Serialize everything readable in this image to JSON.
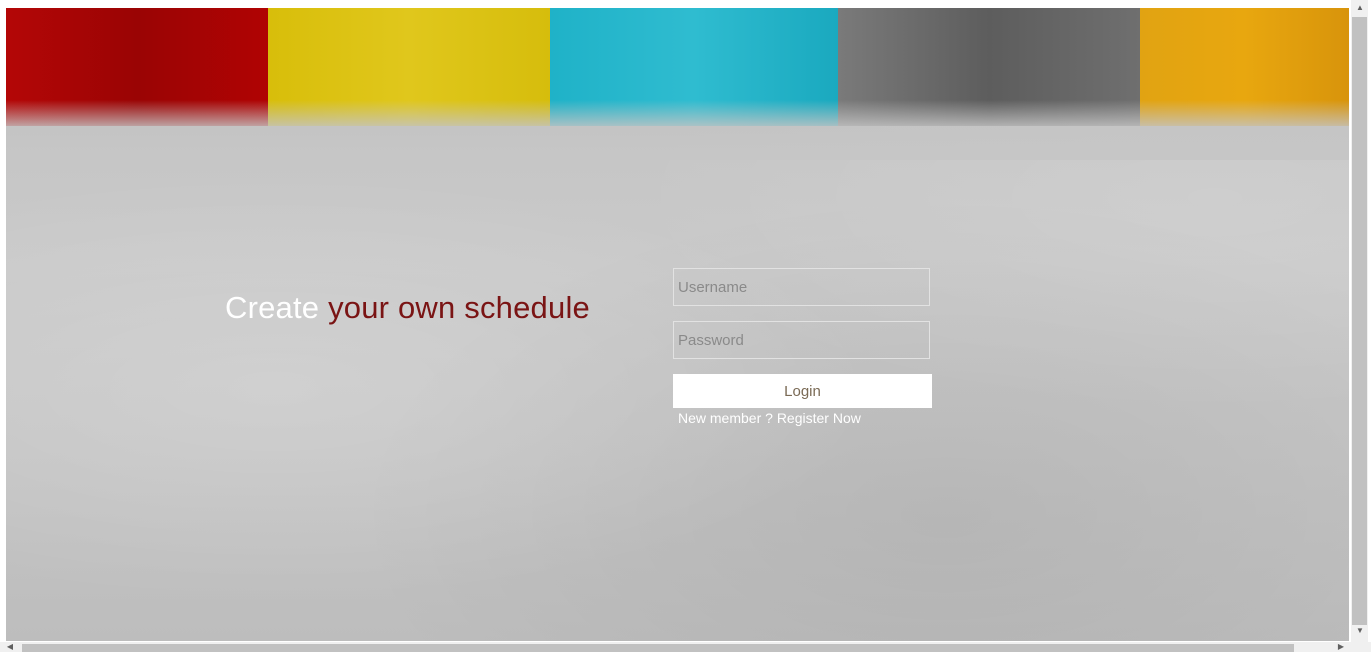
{
  "hero": {
    "tagline_white": "Create",
    "tagline_red": "your own schedule"
  },
  "login_form": {
    "username_placeholder": "Username",
    "password_placeholder": "Password",
    "login_label": "Login",
    "register_prefix": "New member ?",
    "register_link": "Register Now"
  },
  "colors": {
    "stripe_red": "#b40606",
    "stripe_yellow": "#d8be0a",
    "stripe_cyan": "#1fb2c8",
    "stripe_gray": "#6a6a6a",
    "stripe_orange": "#e1a312",
    "tagline_accent": "#7a1414",
    "background": "#c4c4c4"
  },
  "icons": {
    "scroll_up": "▲",
    "scroll_down": "▼",
    "scroll_left": "◀",
    "scroll_right": "▶"
  }
}
